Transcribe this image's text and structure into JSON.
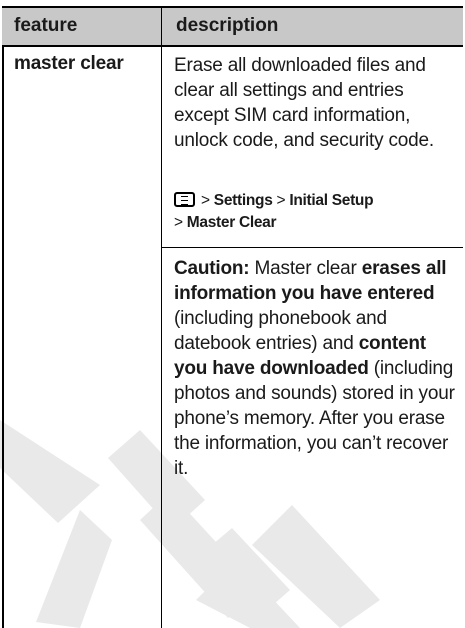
{
  "table": {
    "headers": {
      "feature": "feature",
      "description": "description"
    },
    "rows": [
      {
        "feature": "master clear",
        "description_intro": "Erase all downloaded files and clear all settings and entries except SIM card information, unlock code, and security code.",
        "navigation": {
          "key_icon": "menu-key-icon",
          "path": [
            "Settings",
            "Initial Setup",
            "Master Clear"
          ],
          "separator": ">"
        },
        "caution": {
          "label": "Caution:",
          "t1": " Master clear ",
          "b1": "erases all information you have entered",
          "t2": " (including phonebook and datebook entries) and ",
          "b2": "content you have downloaded",
          "t3": " (including photos and sounds) stored in your phone’s memory. After you erase the information, you can’t recover it."
        }
      }
    ]
  },
  "colors": {
    "header_bg": "#c8c8c8",
    "rule": "#000000",
    "watermark": "#e6e6e6"
  }
}
